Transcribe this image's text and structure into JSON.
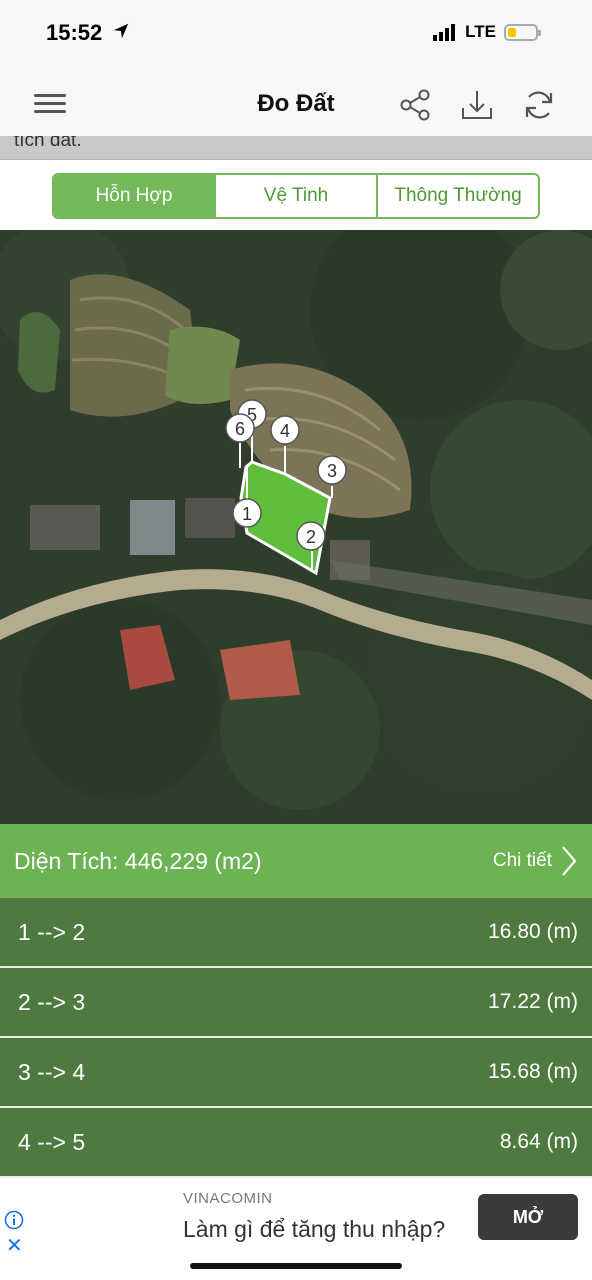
{
  "status_bar": {
    "time": "15:52",
    "network": "LTE",
    "battery_level": 0.3
  },
  "header": {
    "title": "Đo Đất",
    "menu_icon": "menu-icon",
    "share_icon": "share-icon",
    "download_icon": "download-icon",
    "refresh_icon": "refresh-icon"
  },
  "hint": {
    "text": "tích đất."
  },
  "map_types": {
    "options": [
      "Hỗn Hợp",
      "Vệ Tinh",
      "Thông Thường"
    ],
    "selected": "Hỗn Hợp"
  },
  "map": {
    "markers": [
      "1",
      "2",
      "3",
      "4",
      "5",
      "6"
    ],
    "polygon_color": "#5fbe3c"
  },
  "area": {
    "label": "Diện Tích: 446,229 (m2)",
    "detail_label": "Chi tiết"
  },
  "segments": [
    {
      "name": "1 --> 2",
      "length": "16.80 (m)"
    },
    {
      "name": "2 --> 3",
      "length": "17.22 (m)"
    },
    {
      "name": "3 --> 4",
      "length": "15.68 (m)"
    },
    {
      "name": "4 --> 5",
      "length": "8.64 (m)"
    }
  ],
  "ad": {
    "advertiser": "VINACOMIN",
    "headline": "Làm gì để tăng thu nhập?",
    "button_label": "MỞ"
  },
  "colors": {
    "accent_green": "#73b95a",
    "area_bar": "#6db354",
    "segment_row": "#4f7a3f"
  }
}
